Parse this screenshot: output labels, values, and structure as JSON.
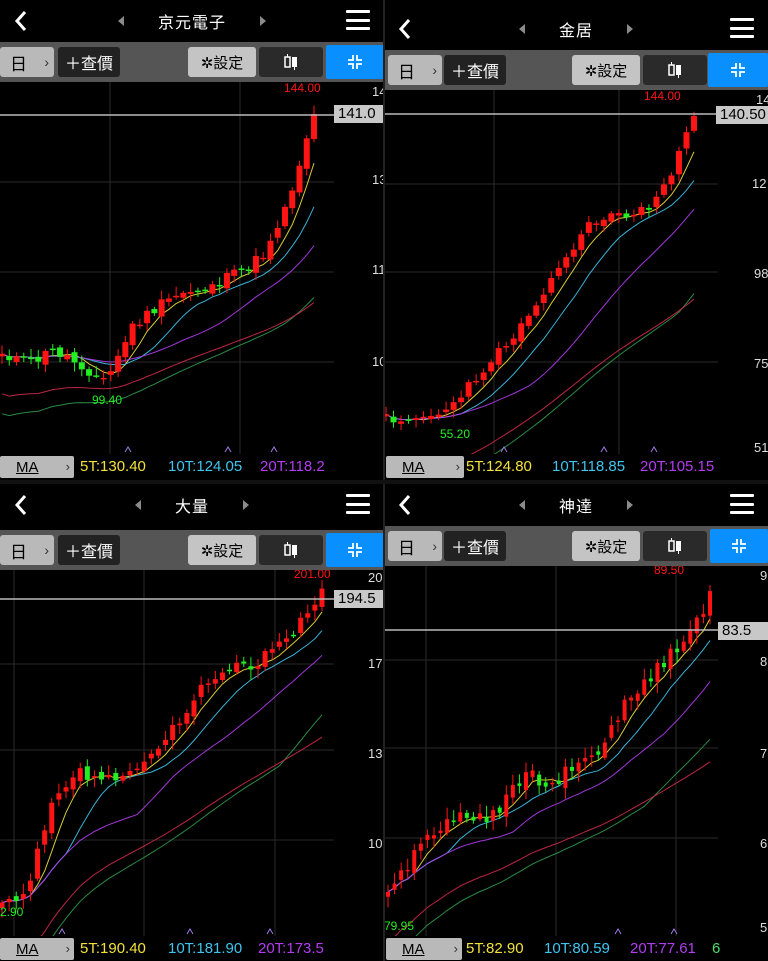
{
  "colors": {
    "up": "#ff1414",
    "down": "#22ee22",
    "ma5": "#f2e23a",
    "ma10": "#3fc6f0",
    "ma20": "#b13cf0",
    "accent": "#0a8fff"
  },
  "common": {
    "period_label": "日",
    "add_price_label": "＋查價",
    "settings_label": "✲設定",
    "ma_label": "MA",
    "back_icon": "chevron-left-icon",
    "menu_icon": "hamburger-menu-icon",
    "candle_icon": "candlestick-icon",
    "focus_icon": "crosshair-focus-icon"
  },
  "panels": [
    {
      "id": "p1",
      "title": "京元電子",
      "high_label": "144.00",
      "low_label": "99.40",
      "current_price": "141.0",
      "y_axis": [
        "14",
        "13",
        "11",
        "10"
      ],
      "ma5": "5T:130.40",
      "ma10": "10T:124.05",
      "ma20": "20T:118.2"
    },
    {
      "id": "p2",
      "title": "金居",
      "high_label": "144.00",
      "low_label": "55.20",
      "current_price": "140.50",
      "y_axis": [
        "14",
        "12",
        "98",
        "75",
        "51"
      ],
      "ma5": "5T:124.80",
      "ma10": "10T:118.85",
      "ma20": "20T:105.15"
    },
    {
      "id": "p3",
      "title": "大量",
      "high_label": "201.00",
      "low_label": "2.90",
      "current_price": "194.5",
      "y_axis": [
        "20",
        "17",
        "13",
        "10"
      ],
      "ma5": "5T:190.40",
      "ma10": "10T:181.90",
      "ma20": "20T:173.5"
    },
    {
      "id": "p4",
      "title": "神達",
      "high_label": "89.50",
      "low_label": "79.95",
      "current_price": "83.5",
      "y_axis": [
        "9",
        "8",
        "7",
        "6",
        "5"
      ],
      "ma5": "5T:82.90",
      "ma10": "10T:80.59",
      "ma20": "20T:77.61",
      "ma60_partial": "6"
    }
  ]
}
